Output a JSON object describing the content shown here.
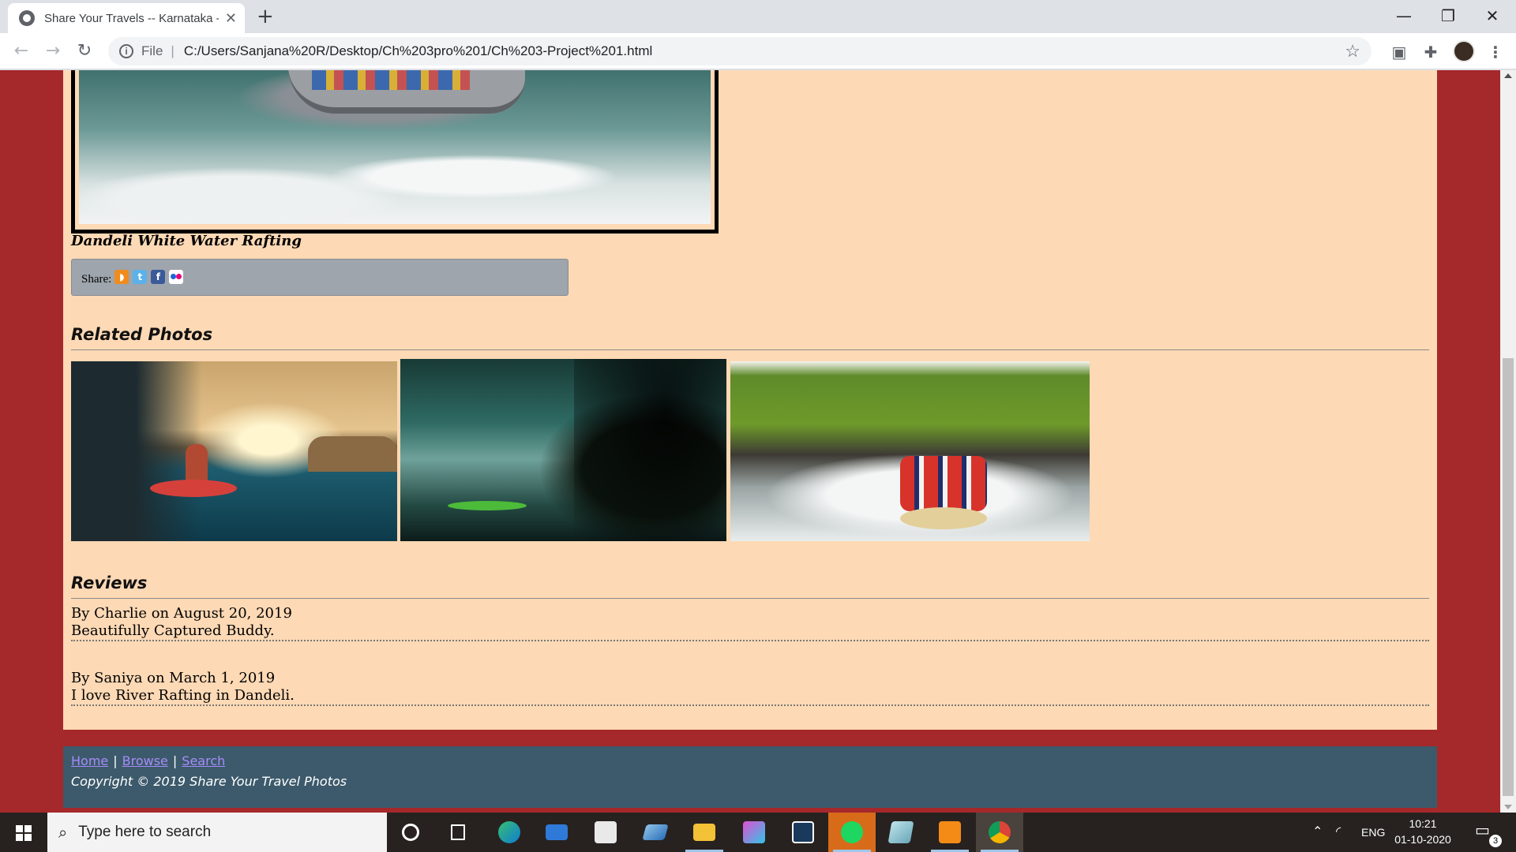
{
  "browser": {
    "tab_title": "Share Your Travels -- Karnataka -",
    "tab_close": "✕",
    "new_tab": "+",
    "url_scheme_label": "File",
    "url_separator": "|",
    "url": "C:/Users/Sanjana%20R/Desktop/Ch%203pro%201/Ch%203-Project%201.html",
    "window_controls": [
      "—",
      "❐",
      "✕"
    ]
  },
  "page": {
    "photo_caption": "Dandeli White Water Rafting",
    "share": {
      "label": "Share:",
      "icons": [
        "rss-icon",
        "twitter-icon",
        "facebook-icon",
        "flickr-icon"
      ],
      "twitter_glyph": "t",
      "facebook_glyph": "f"
    },
    "related_title": "Related Photos",
    "reviews_title": "Reviews",
    "reviews": [
      {
        "byline": "By Charlie on August 20, 2019",
        "text": "Beautifully Captured Buddy."
      },
      {
        "byline": "By Saniya on March 1, 2019",
        "text": "I love River Rafting in Dandeli."
      }
    ],
    "footer": {
      "links": [
        "Home",
        "Browse",
        "Search"
      ],
      "separator": "|",
      "copyright": "Copyright © 2019 Share Your Travel Photos"
    },
    "colors": {
      "page_background": "#a5282a",
      "content_background": "#fdd9b5",
      "footer_background": "#3c5a6b",
      "share_box": "#9ea5ad",
      "link": "#a78bfa"
    }
  },
  "taskbar": {
    "search_placeholder": "Type here to search",
    "apps": [
      "cortana-icon",
      "task-view-icon",
      "edge-icon",
      "mail-icon",
      "store-icon",
      "remote-desktop-icon",
      "file-explorer-icon",
      "paint3d-icon",
      "dev-tool-icon",
      "spotify-icon",
      "notes-icon",
      "sublime-text-icon",
      "chrome-icon"
    ],
    "language": "ENG",
    "time": "10:21",
    "date": "01-10-2020",
    "notifications": "3"
  }
}
